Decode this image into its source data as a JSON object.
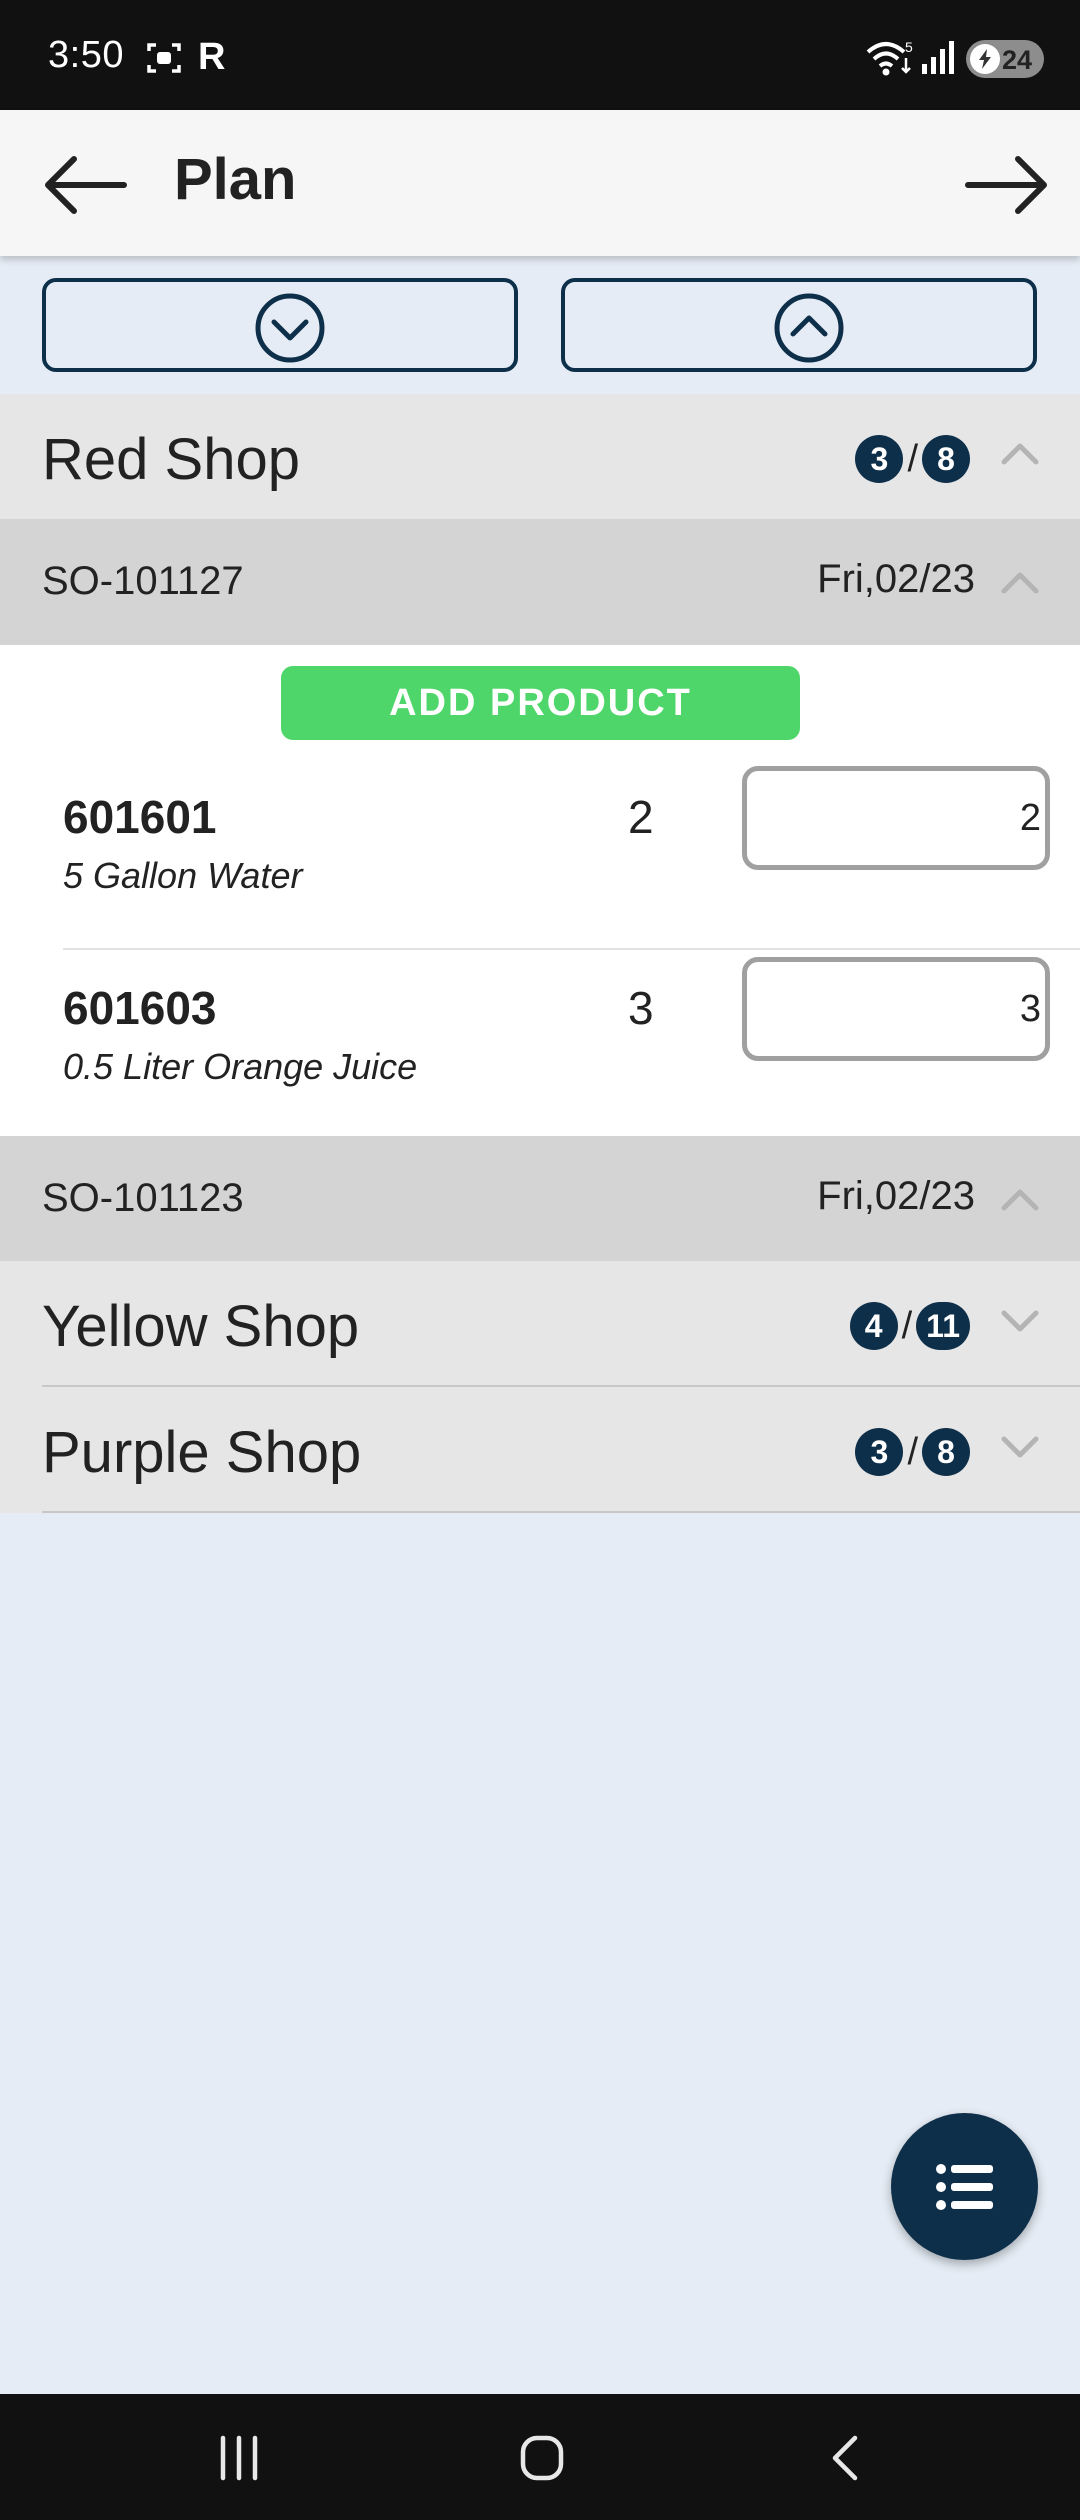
{
  "status_bar": {
    "time": "3:50",
    "carrier_glyph": "R",
    "battery_level": "24",
    "icons": [
      "screen-record-icon",
      "wifi-icon",
      "signal-icon",
      "battery-charging-icon"
    ]
  },
  "app_bar": {
    "title": "Plan",
    "back_icon": "arrow-left-icon",
    "forward_icon": "arrow-right-icon"
  },
  "toolbar": {
    "collapse_icon": "chevron-down-circle-icon",
    "expand_icon": "chevron-up-circle-icon"
  },
  "shops": [
    {
      "name": "Red Shop",
      "done": "3",
      "total": "8",
      "expanded": true,
      "orders": [
        {
          "id": "SO-101127",
          "date": "Fri,02/23",
          "expanded": true,
          "add_label": "ADD PRODUCT",
          "products": [
            {
              "code": "601601",
              "name": "5 Gallon Water",
              "qty": "2",
              "input_value": "2"
            },
            {
              "code": "601603",
              "name": "0.5 Liter Orange Juice",
              "qty": "3",
              "input_value": "3"
            }
          ]
        },
        {
          "id": "SO-101123",
          "date": "Fri,02/23",
          "expanded": true
        }
      ]
    },
    {
      "name": "Yellow Shop",
      "done": "4",
      "total": "11",
      "expanded": false
    },
    {
      "name": "Purple Shop",
      "done": "3",
      "total": "8",
      "expanded": false
    }
  ],
  "fab": {
    "icon": "list-icon"
  },
  "nav_bar": {
    "icons": [
      "recents-icon",
      "home-icon",
      "back-nav-icon"
    ]
  },
  "colors": {
    "primary": "#0e2f4a",
    "accent_green": "#4fd66a",
    "background": "#e5ecf5",
    "shop_header": "#e6e6e6",
    "order_header": "#d4d4d4"
  }
}
